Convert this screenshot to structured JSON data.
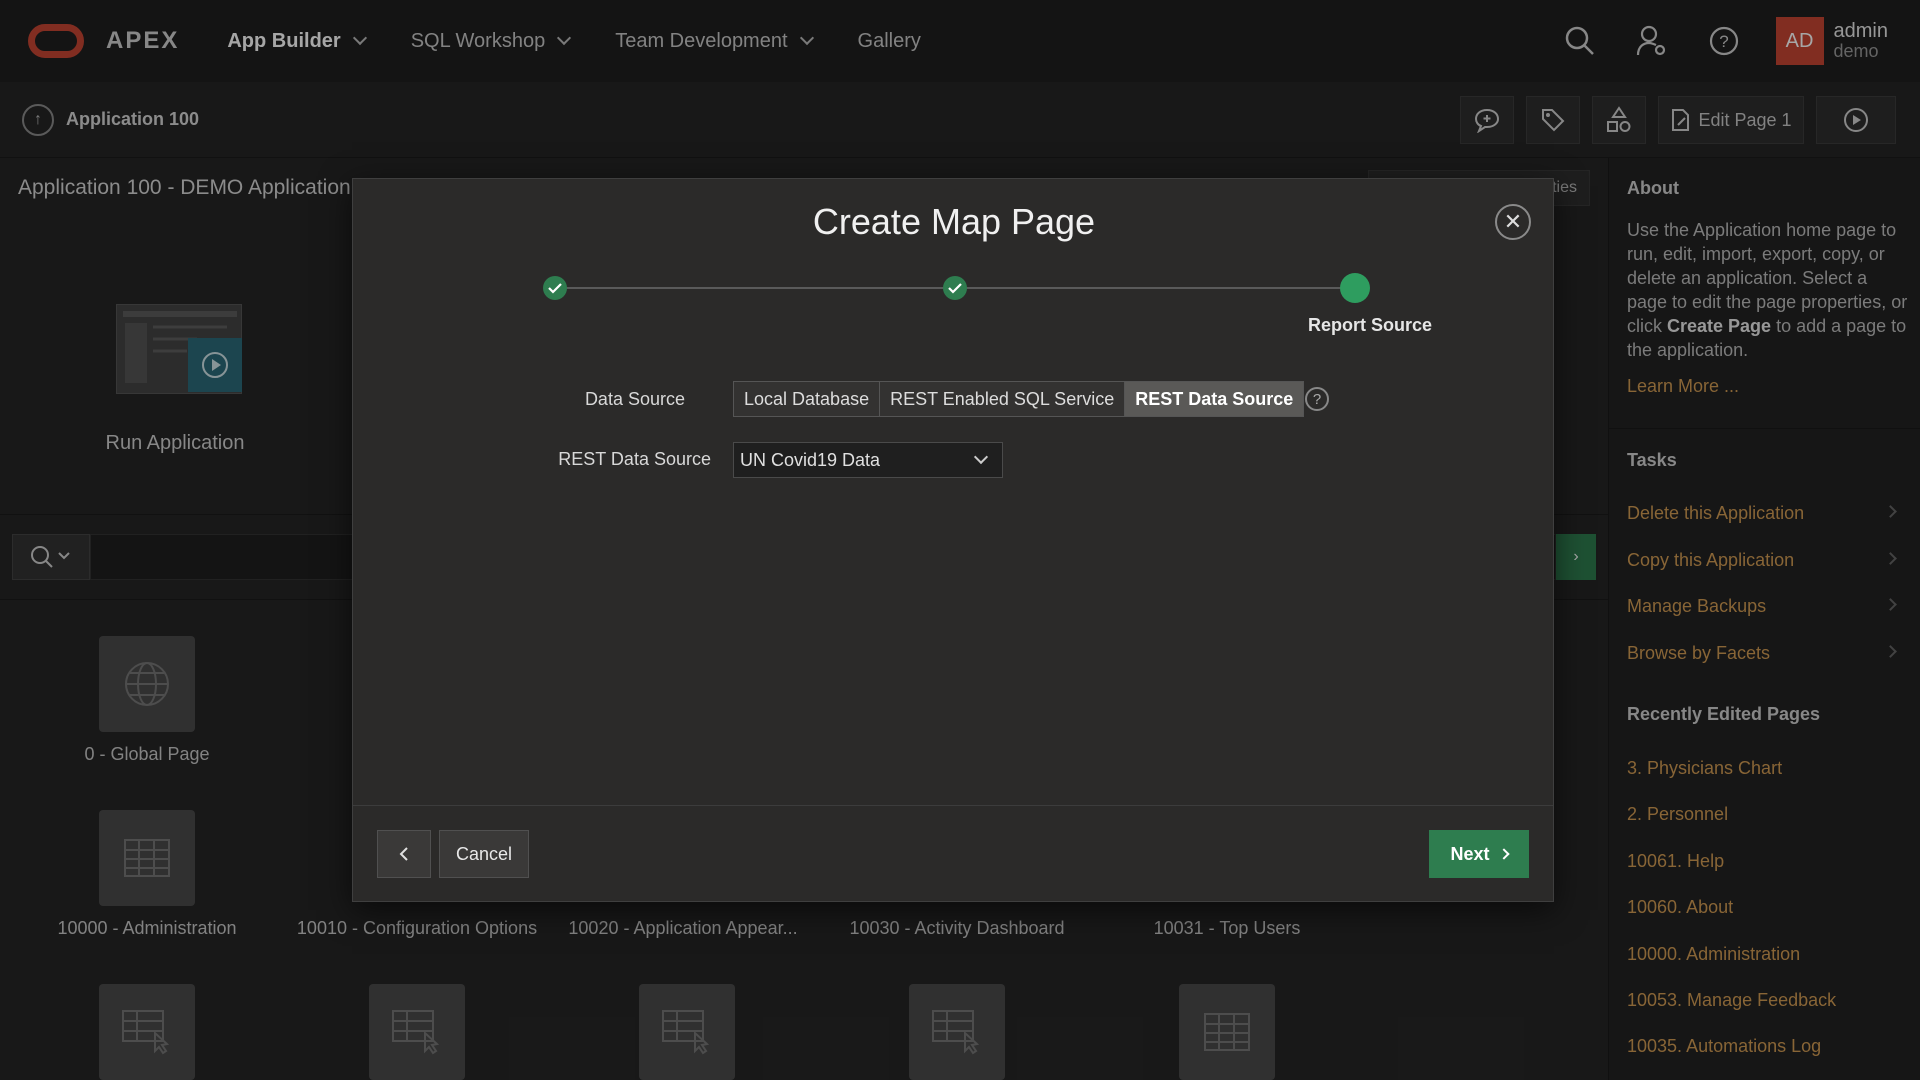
{
  "header": {
    "brand": "APEX",
    "nav": [
      {
        "label": "App Builder"
      },
      {
        "label": "SQL Workshop"
      },
      {
        "label": "Team Development"
      },
      {
        "label": "Gallery"
      }
    ],
    "avatar_initials": "AD",
    "user_name": "admin",
    "workspace": "demo"
  },
  "breadcrumb": {
    "label": "Application 100",
    "edit_page_label": "Edit Page 1"
  },
  "app_home": {
    "title": "Application 100 - DEMO Application",
    "props_button": "ties",
    "run_label": "Run Application",
    "tiles": [
      {
        "label": "0 - Global Page"
      },
      {
        "label": "10000 - Administration"
      },
      {
        "label": "10010 - Configuration Options"
      },
      {
        "label": "10020 - Application Appear..."
      },
      {
        "label": "10030 - Activity Dashboard"
      },
      {
        "label": "10031 - Top Users"
      }
    ]
  },
  "sidebar": {
    "about_heading": "About",
    "about_text_1": "Use the Application home page to run, edit, import, export, copy, or delete an application. Select a page to edit the page properties, or click ",
    "about_bold": "Create Page",
    "about_text_2": " to add a page to the application.",
    "learn_more": "Learn More ...",
    "tasks_heading": "Tasks",
    "tasks": [
      {
        "label": "Delete this Application"
      },
      {
        "label": "Copy this Application"
      },
      {
        "label": "Manage Backups"
      },
      {
        "label": "Browse by Facets"
      }
    ],
    "recent_heading": "Recently Edited Pages",
    "recent": [
      {
        "label": "3. Physicians Chart"
      },
      {
        "label": "2. Personnel"
      },
      {
        "label": "10061. Help"
      },
      {
        "label": "10060. About"
      },
      {
        "label": "10000. Administration"
      },
      {
        "label": "10053. Manage Feedback"
      },
      {
        "label": "10035. Automations Log"
      }
    ]
  },
  "modal": {
    "title": "Create Map Page",
    "current_step_label": "Report Source",
    "data_source_label": "Data Source",
    "data_source_options": [
      {
        "label": "Local Database"
      },
      {
        "label": "REST Enabled SQL Service"
      },
      {
        "label": "REST Data Source"
      }
    ],
    "selected_data_source": "REST Data Source",
    "rest_source_label": "REST Data Source",
    "rest_source_value": "UN Covid19 Data",
    "help_glyph": "?",
    "cancel_label": "Cancel",
    "next_label": "Next"
  },
  "colors": {
    "accent_green": "#2e7d4f",
    "brand_red": "#c74634",
    "link_orange": "#d29b53"
  }
}
